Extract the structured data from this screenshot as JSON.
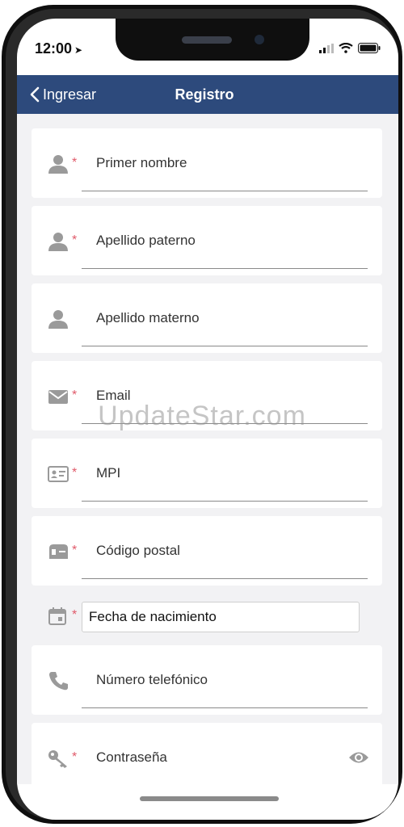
{
  "status_bar": {
    "time": "12:00"
  },
  "navbar": {
    "back_label": "Ingresar",
    "title": "Registro"
  },
  "fields": [
    {
      "label": "Primer nombre",
      "required": true
    },
    {
      "label": "Apellido paterno",
      "required": true
    },
    {
      "label": "Apellido materno",
      "required": false
    },
    {
      "label": "Email",
      "required": true
    },
    {
      "label": "MPI",
      "required": true
    },
    {
      "label": "Código postal",
      "required": true
    },
    {
      "label": "Fecha de nacimiento",
      "required": true
    },
    {
      "label": "Número telefónico",
      "required": false
    },
    {
      "label": "Contraseña",
      "required": true
    }
  ],
  "required_marker": "*",
  "watermark": "UpdateStar.com",
  "colors": {
    "navbar": "#2d4a7c",
    "required": "#e05a6a",
    "background": "#f2f2f4"
  }
}
